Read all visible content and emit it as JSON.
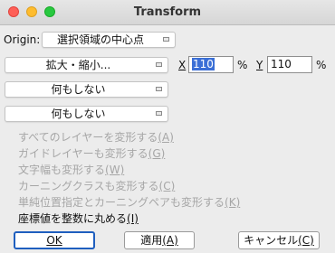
{
  "window": {
    "title": "Transform"
  },
  "origin": {
    "label": "Origin:",
    "value": "選択領域の中心点"
  },
  "scale_select": {
    "value": "拡大・縮小..."
  },
  "x_field": {
    "label": "X",
    "value": "110",
    "unit": "%"
  },
  "y_field": {
    "label": "Y",
    "value": "110",
    "unit": "%"
  },
  "action_select_1": {
    "value": "何もしない"
  },
  "action_select_2": {
    "value": "何もしない"
  },
  "options": [
    {
      "label": "すべてのレイヤーを変形する",
      "key": "(A)",
      "enabled": false
    },
    {
      "label": "ガイドレイヤーも変形する",
      "key": "(G)",
      "enabled": false
    },
    {
      "label": "文字幅も変形する",
      "key": "(W)",
      "enabled": false
    },
    {
      "label": "カーニングクラスも変形する",
      "key": "(C)",
      "enabled": false
    },
    {
      "label": "単純位置指定とカーニングペアも変形する",
      "key": "(K)",
      "enabled": false
    },
    {
      "label": "座標値を整数に丸める",
      "key": "(I)",
      "enabled": true
    }
  ],
  "buttons": {
    "ok": "OK",
    "apply": "適用",
    "apply_key": "(A)",
    "cancel": "キャンセル",
    "cancel_key": "(C)"
  },
  "icons": {
    "dropdown": "popup-arrow-icon"
  }
}
